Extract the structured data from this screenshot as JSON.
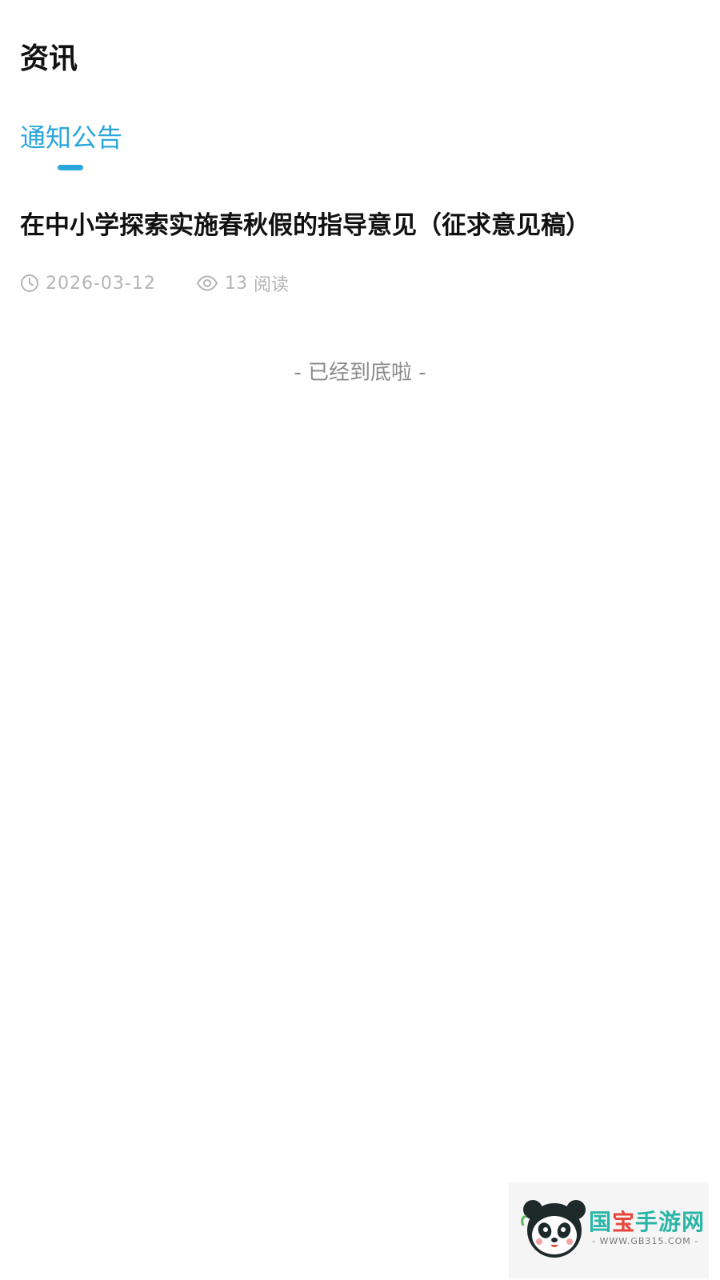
{
  "header": {
    "title": "资讯"
  },
  "tabs": [
    {
      "label": "通知公告",
      "active": true
    }
  ],
  "articles": [
    {
      "title": "在中小学探索实施春秋假的指导意见（征求意见稿）",
      "date": "2026-03-12",
      "views": "13",
      "views_unit": "阅读"
    }
  ],
  "footer": {
    "end_text": "- 已经到底啦 -"
  },
  "watermark": {
    "brand_main": "国",
    "brand_accent": "宝",
    "brand_rest": "手游网",
    "url": "- WWW.GB315.COM -"
  },
  "icons": {
    "date": "clock-icon",
    "views": "eye-icon",
    "watermark_logo": "panda-logo-icon"
  },
  "colors": {
    "accent": "#2aa6da",
    "title": "#111111",
    "meta": "#b4b4b4",
    "end_text": "#8a8a8a"
  }
}
